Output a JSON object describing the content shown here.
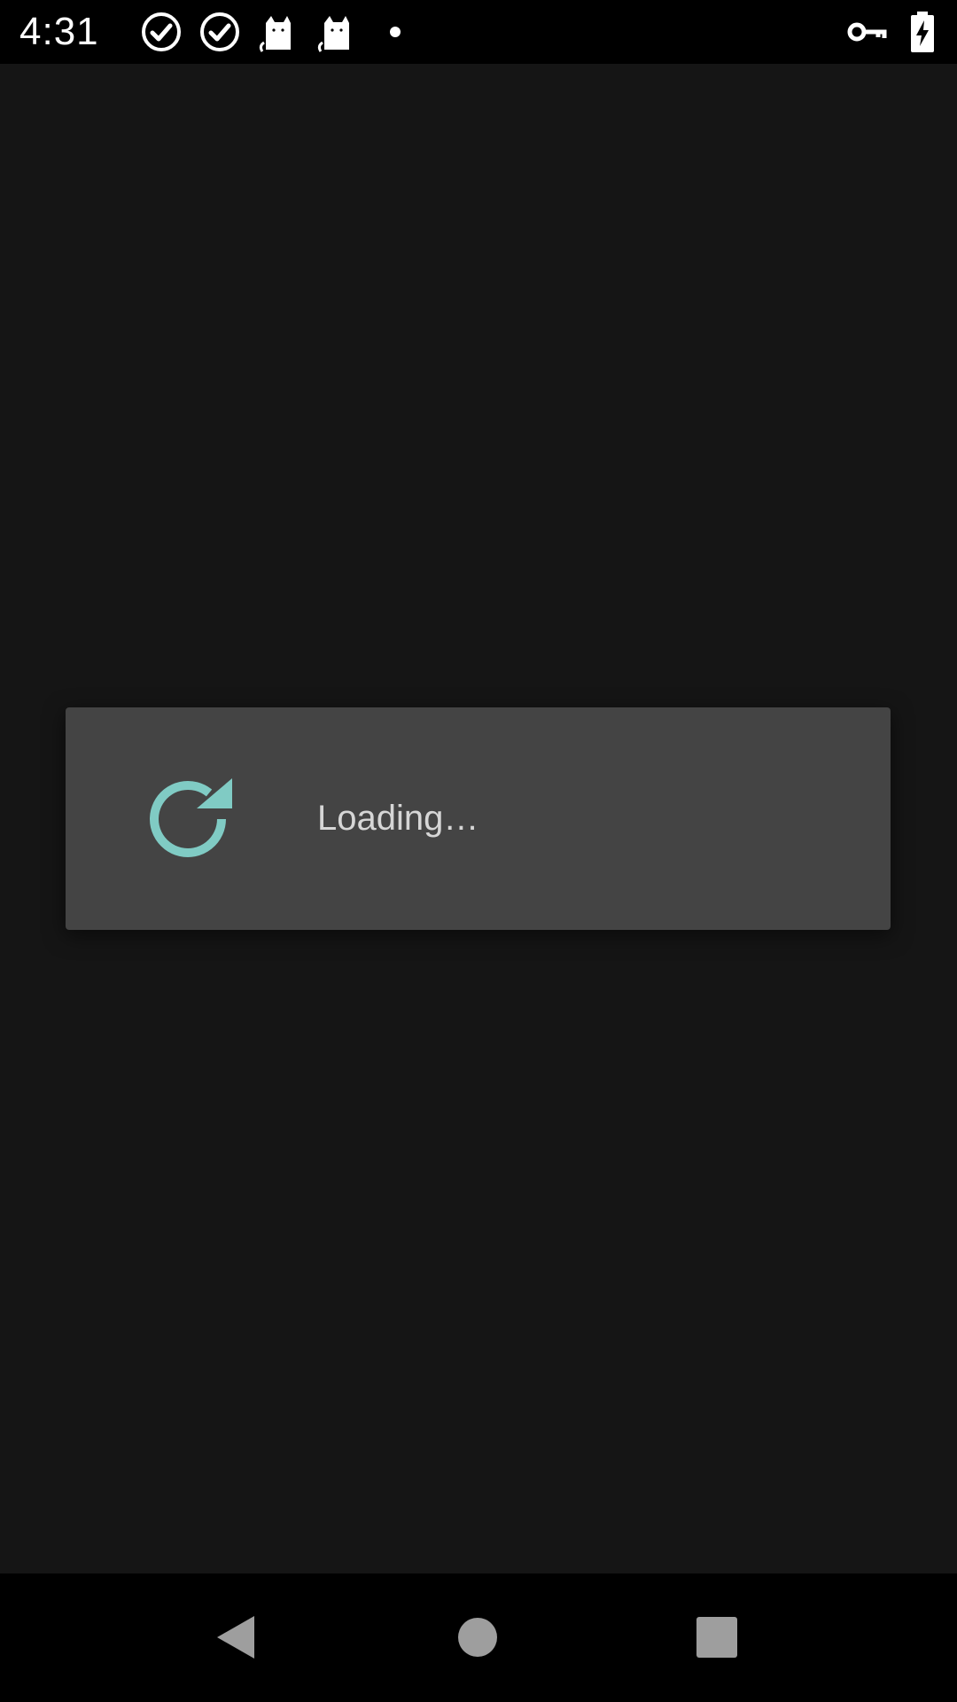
{
  "status_bar": {
    "time": "4:31",
    "notification_icons": [
      "check-circle-icon",
      "check-circle-icon",
      "cat-icon",
      "cat-icon",
      "dot-icon"
    ],
    "system_icons": [
      "vpn-key-icon",
      "battery-charging-icon"
    ]
  },
  "dialog": {
    "message": "Loading…",
    "spinner_icon": "refresh-icon",
    "spinner_color": "#80cbc4",
    "background_color": "#444444"
  },
  "nav_bar": {
    "buttons": [
      "back-icon",
      "home-icon",
      "recents-icon"
    ],
    "icon_color": "#9e9e9e"
  },
  "colors": {
    "screen_background": "#151515",
    "bar_background": "#000000",
    "text_color": "#d6d6d6"
  }
}
